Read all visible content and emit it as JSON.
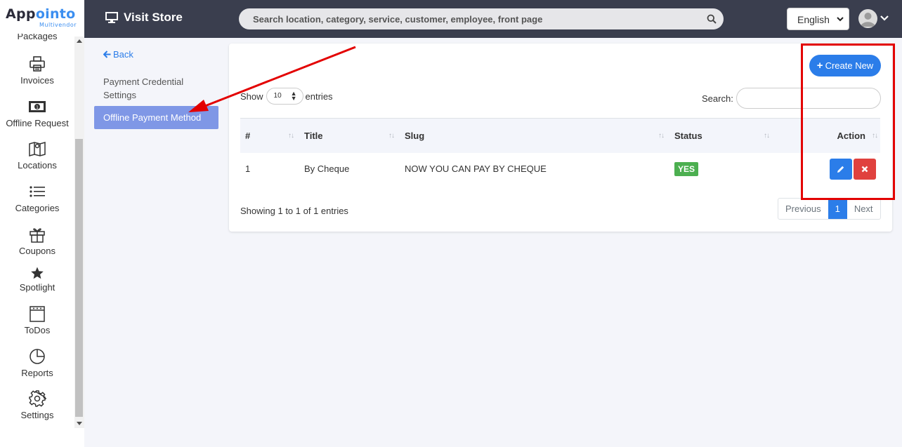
{
  "brand": {
    "name_part1": "App",
    "name_part2": "ointo",
    "sub": "Multivendor"
  },
  "sidebar": {
    "items": [
      {
        "label": "Packages",
        "icon": "package-icon"
      },
      {
        "label": "Invoices",
        "icon": "printer-icon"
      },
      {
        "label": "Offline Request",
        "icon": "money-icon"
      },
      {
        "label": "Locations",
        "icon": "map-icon"
      },
      {
        "label": "Categories",
        "icon": "list-icon"
      },
      {
        "label": "Coupons",
        "icon": "gift-icon"
      },
      {
        "label": "Spotlight",
        "icon": "star-icon"
      },
      {
        "label": "ToDos",
        "icon": "notepad-icon"
      },
      {
        "label": "Reports",
        "icon": "pie-chart-icon"
      },
      {
        "label": "Settings",
        "icon": "gear-icon"
      }
    ]
  },
  "topbar": {
    "visit_store": "Visit Store",
    "search_placeholder": "Search location, category, service, customer, employee, front page",
    "language": "English"
  },
  "settings_menu": {
    "back": "Back",
    "items": [
      {
        "label": "Payment Credential Settings",
        "active": false
      },
      {
        "label": "Offline Payment Method",
        "active": true
      }
    ]
  },
  "table_panel": {
    "create_button": "Create New",
    "show_label": "Show",
    "page_size": "10",
    "entries_label": "entries",
    "search_label": "Search:",
    "columns": [
      "#",
      "Title",
      "Slug",
      "Status",
      "Action"
    ],
    "rows": [
      {
        "num": "1",
        "title": "By Cheque",
        "slug": "NOW YOU CAN PAY BY CHEQUE",
        "status": "YES"
      }
    ],
    "info": "Showing 1 to 1 of 1 entries",
    "pagination": {
      "previous": "Previous",
      "current": "1",
      "next": "Next"
    }
  },
  "colors": {
    "topbar": "#3a3e4e",
    "accent": "#2b7de9",
    "active_menu": "#7f97e6",
    "status_yes": "#4caf50",
    "delete": "#e0413e",
    "annotation": "#e30000"
  }
}
